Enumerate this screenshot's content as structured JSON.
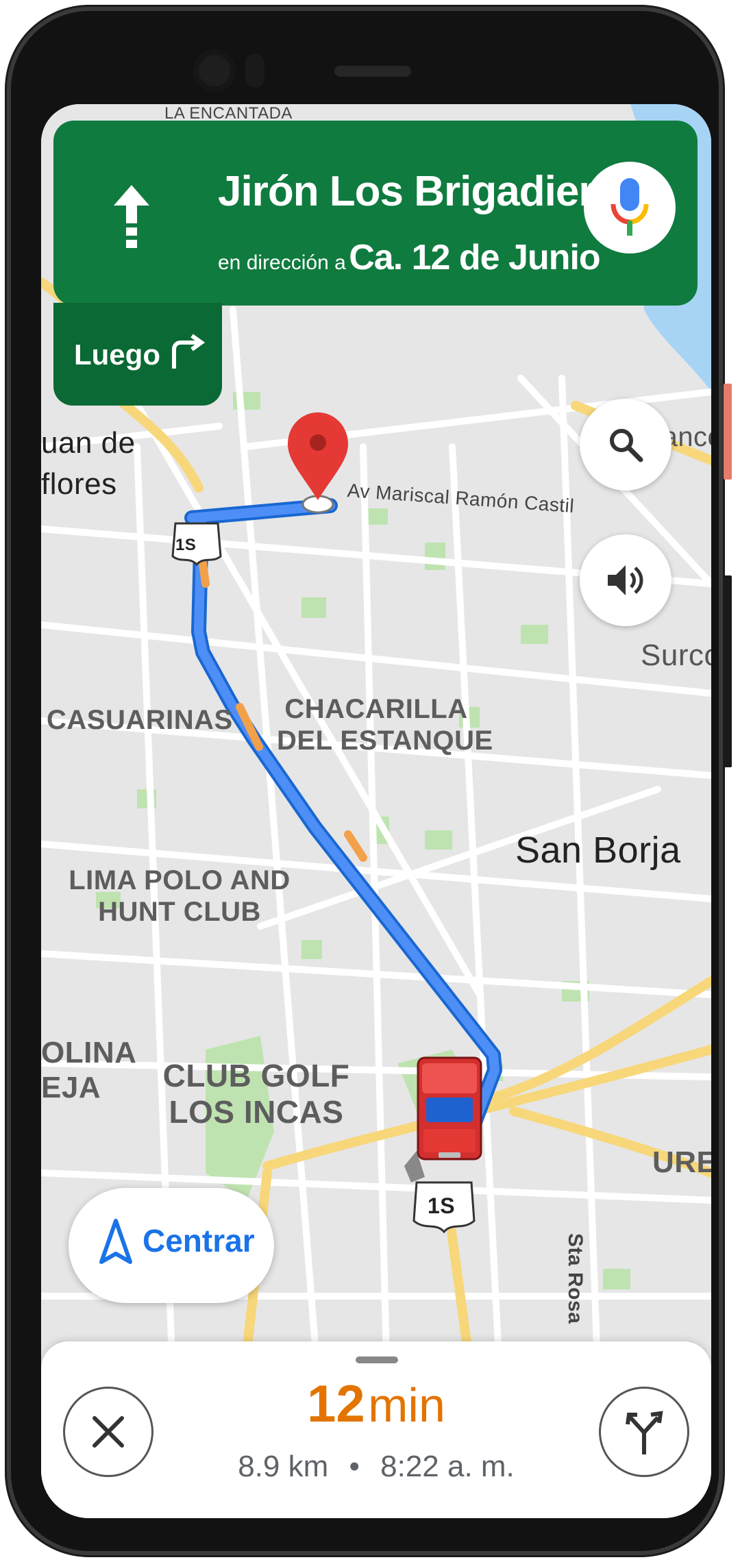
{
  "navigation": {
    "street": "Jirón Los Brigadieres",
    "direction_prefix": "en dirección a",
    "direction_target": "Ca. 12 de Junio",
    "maneuver_icon": "straight-arrow-icon",
    "then_label": "Luego",
    "then_icon": "turn-right-icon"
  },
  "map": {
    "labels": {
      "la_encantada": "LA ENCANTADA",
      "juan_de": "uan de",
      "flores": "flores",
      "mariscal": "Av Mariscal Ramón Castilla",
      "blanco": "Blanco",
      "surco": "Surco",
      "casuarinas": "CASUARINAS",
      "chacarilla": "CHACARILLA\nDEL ESTANQUE",
      "san_borja": "San Borja",
      "lima_polo": "LIMA POLO AND\nHUNT CLUB",
      "molina": "OLINA\nEJA",
      "club_golf": "CLUB GOLF\nLOS INCAS",
      "ure": "URE",
      "sta_rosa": "Sta Rosa"
    },
    "route_shields": [
      "1S",
      "1S"
    ],
    "route_color": "#4285f4"
  },
  "controls": {
    "search_icon": "search-icon",
    "sound_icon": "volume-icon",
    "voice_icon": "mic-icon",
    "recenter_label": "Centrar"
  },
  "trip": {
    "eta_number": "12",
    "eta_unit": "min",
    "distance": "8.9 km",
    "separator": "•",
    "arrival_time": "8:22 a. m.",
    "close_icon": "close-icon",
    "alt_routes_icon": "alternate-routes-icon"
  },
  "colors": {
    "banner": "#0f7b3f",
    "banner_dark": "#0a6934",
    "eta": "#e37400",
    "accent_blue": "#1a73e8"
  }
}
